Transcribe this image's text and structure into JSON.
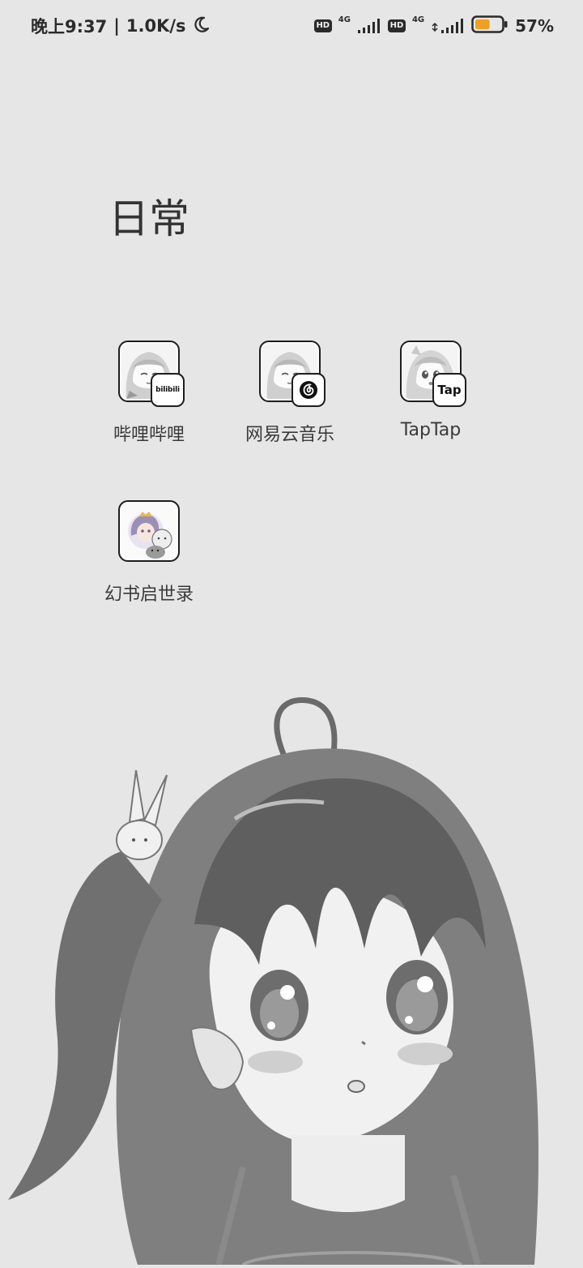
{
  "status_bar": {
    "time": "晚上9:37",
    "separator": "|",
    "net_speed": "1.0K/s",
    "moon_icon": "moon-icon",
    "sim1_badge": "HD",
    "sim1_network": "4G",
    "sim2_badge": "HD",
    "sim2_network": "4G",
    "signal_icon": "signal-icon",
    "battery_icon": "battery-icon",
    "battery_level": 0.57,
    "battery_percent": "57%",
    "battery_fill_color": "#f0a020"
  },
  "folder": {
    "title": "日常",
    "apps": [
      {
        "label": "哔哩哔哩",
        "badge": "bilibili",
        "icon": "bilibili-icon"
      },
      {
        "label": "网易云音乐",
        "badge": "netease-music-logo",
        "icon": "netease-music-icon"
      },
      {
        "label": "TapTap",
        "badge": "Tap",
        "icon": "taptap-icon"
      },
      {
        "label": "幻书启世录",
        "badge": "",
        "icon": "huanshu-icon"
      }
    ]
  },
  "colors": {
    "background": "#e6e6e6",
    "icon_border": "#1e1e1e"
  }
}
